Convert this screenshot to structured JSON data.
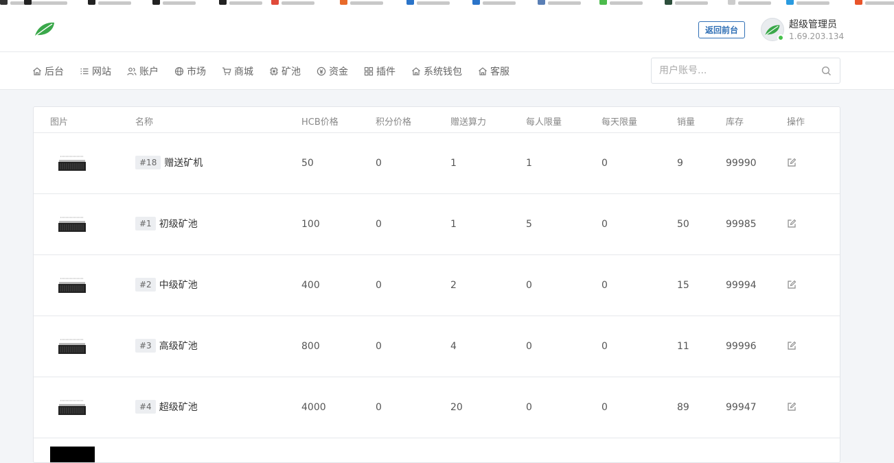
{
  "header": {
    "back_button": "返回前台",
    "user_name": "超级管理员",
    "user_ip": "1.69.203.134"
  },
  "nav": [
    {
      "label": "后台",
      "icon": "home-icon"
    },
    {
      "label": "网站",
      "icon": "list-icon"
    },
    {
      "label": "账户",
      "icon": "users-icon"
    },
    {
      "label": "市场",
      "icon": "globe-icon"
    },
    {
      "label": "商城",
      "icon": "cart-icon"
    },
    {
      "label": "矿池",
      "icon": "chip-icon"
    },
    {
      "label": "资金",
      "icon": "coin-icon"
    },
    {
      "label": "插件",
      "icon": "grid-icon"
    },
    {
      "label": "系统钱包",
      "icon": "home-icon"
    },
    {
      "label": "客服",
      "icon": "home-icon"
    }
  ],
  "search": {
    "placeholder": "用户账号..."
  },
  "table": {
    "headers": [
      "图片",
      "名称",
      "HCB价格",
      "积分价格",
      "赠送算力",
      "每人限量",
      "每天限量",
      "销量",
      "库存",
      "操作"
    ],
    "rows": [
      {
        "id": "#18",
        "name": "赠送矿机",
        "hcb": "50",
        "points": "0",
        "power": "1",
        "per_user": "1",
        "per_day": "0",
        "sales": "9",
        "stock": "99990"
      },
      {
        "id": "#1",
        "name": "初级矿池",
        "hcb": "100",
        "points": "0",
        "power": "1",
        "per_user": "5",
        "per_day": "0",
        "sales": "50",
        "stock": "99985"
      },
      {
        "id": "#2",
        "name": "中级矿池",
        "hcb": "400",
        "points": "0",
        "power": "2",
        "per_user": "0",
        "per_day": "0",
        "sales": "15",
        "stock": "99994"
      },
      {
        "id": "#3",
        "name": "高级矿池",
        "hcb": "800",
        "points": "0",
        "power": "4",
        "per_user": "0",
        "per_day": "0",
        "sales": "11",
        "stock": "99996"
      },
      {
        "id": "#4",
        "name": "超级矿池",
        "hcb": "4000",
        "points": "0",
        "power": "20",
        "per_user": "0",
        "per_day": "0",
        "sales": "89",
        "stock": "99947"
      }
    ]
  },
  "colors": {
    "accent": "#2f6fb5",
    "logo_green": "#3aa84a",
    "online": "#45c04a"
  }
}
